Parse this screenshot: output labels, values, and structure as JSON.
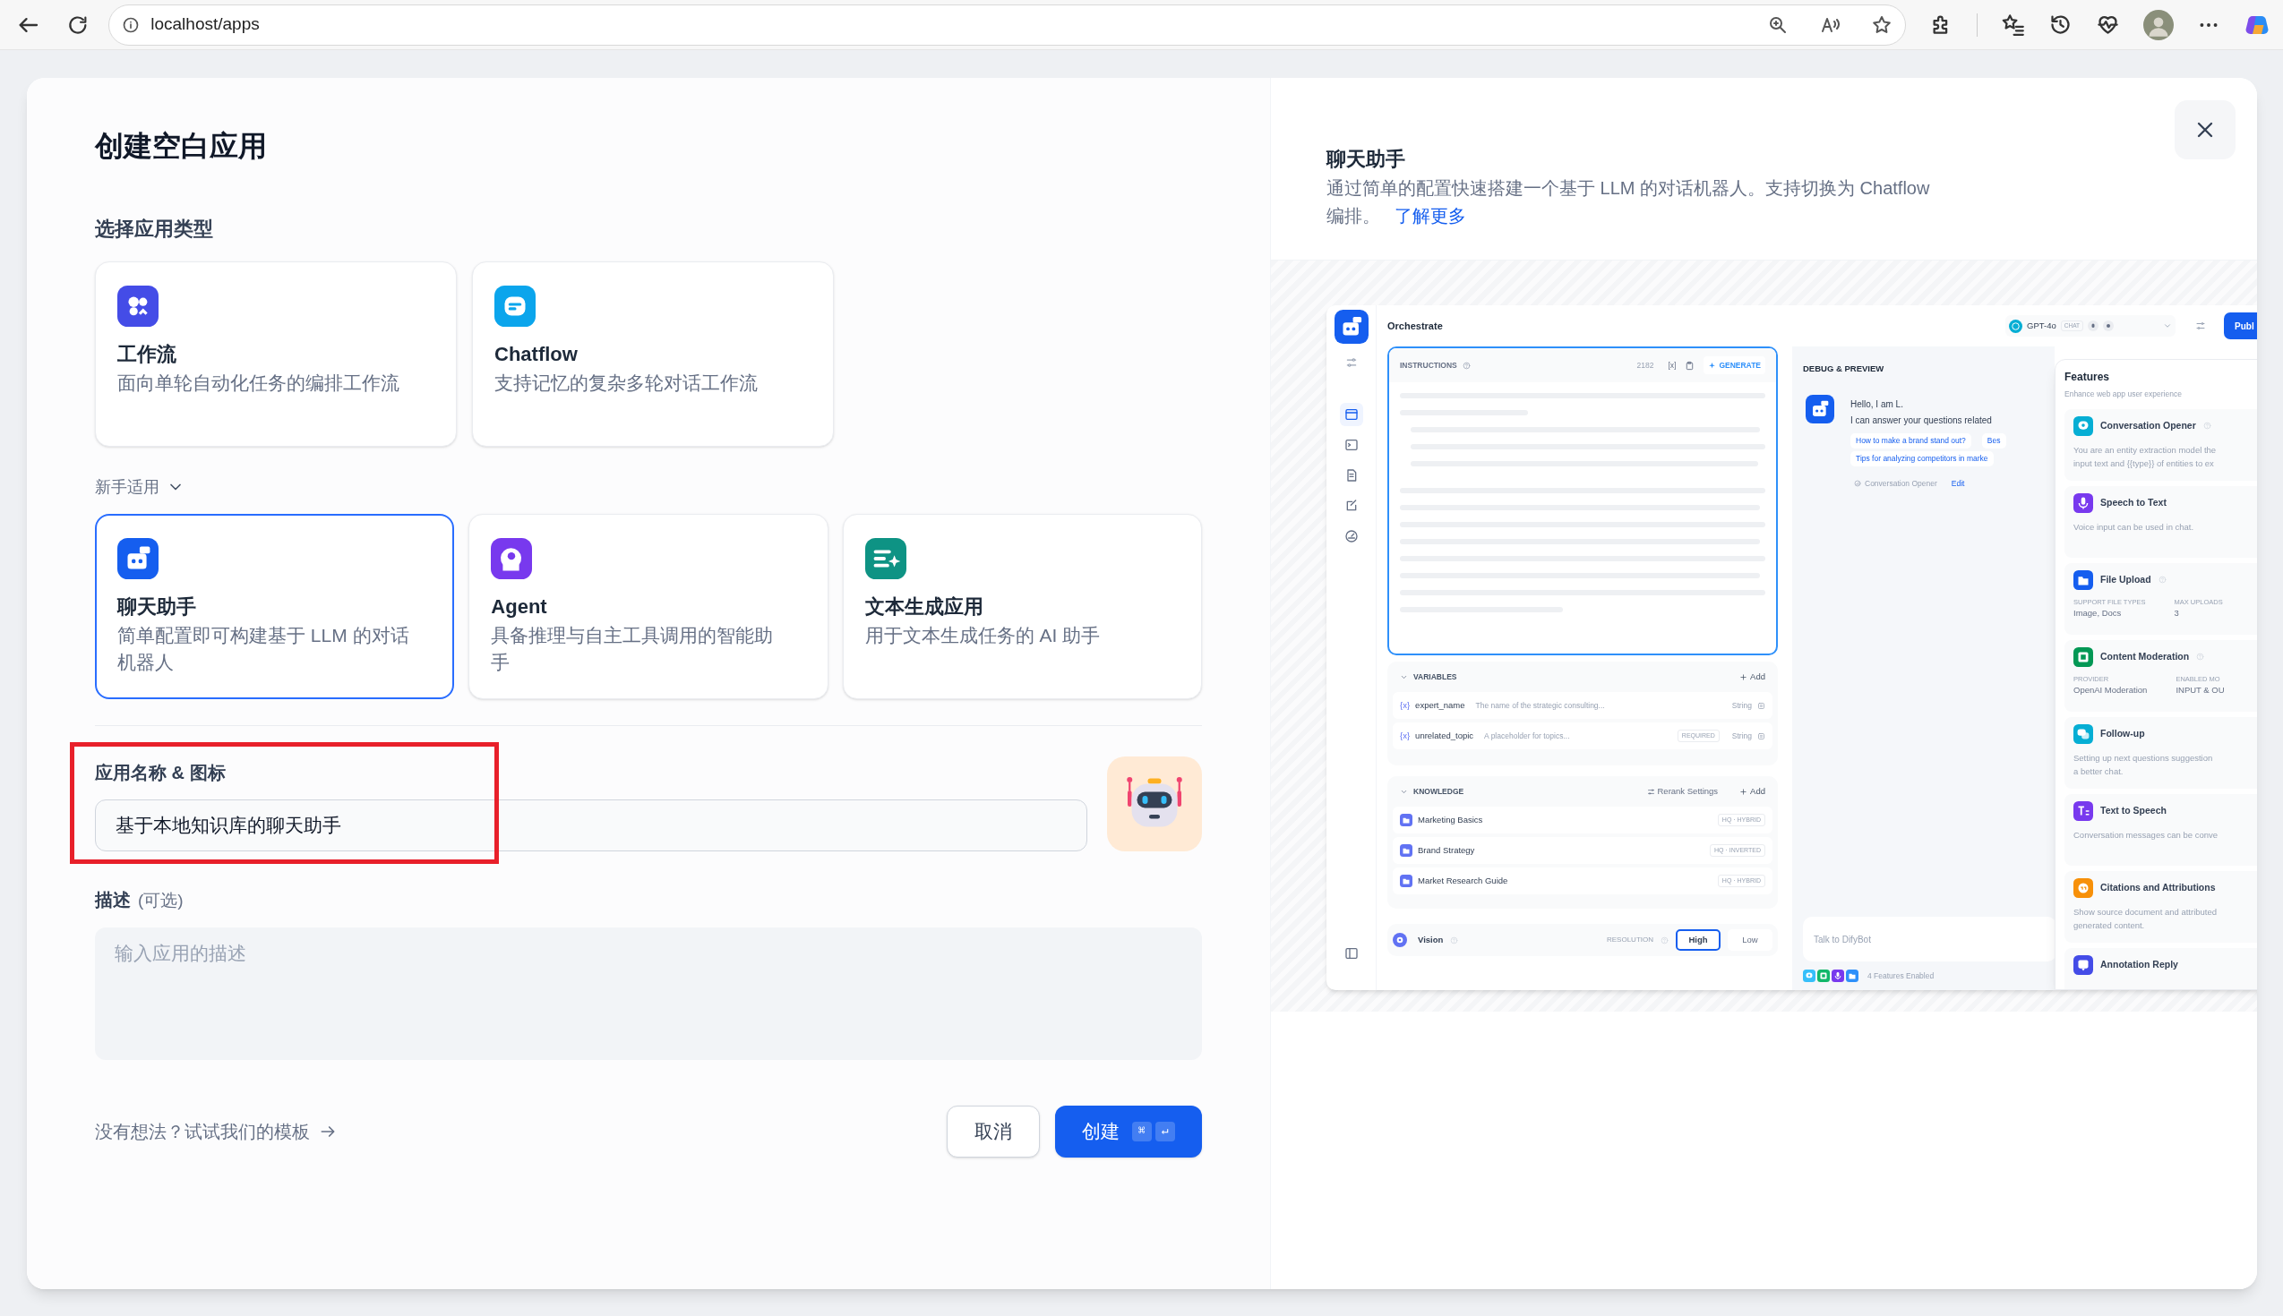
{
  "browser": {
    "url": "localhost/apps"
  },
  "title": "创建空白应用",
  "section_label": "选择应用类型",
  "app_types": [
    {
      "name": "工作流",
      "description": "面向单轮自动化任务的编排工作流",
      "color": "#444ce7",
      "selected": false
    },
    {
      "name": "Chatflow",
      "description": "支持记忆的复杂多轮对话工作流",
      "color": "#0ba5ec",
      "selected": false
    }
  ],
  "beginner_toggle": {
    "label": "新手适用",
    "expanded": true
  },
  "beginner_types": [
    {
      "name": "聊天助手",
      "description": "简单配置即可构建基于 LLM 的对话机器人",
      "color": "#155eef",
      "selected": true
    },
    {
      "name": "Agent",
      "description": "具备推理与自主工具调用的智能助手",
      "color": "#7839ee",
      "selected": false
    },
    {
      "name": "文本生成应用",
      "description": "用于文本生成任务的 AI 助手",
      "color": "#0e9384",
      "selected": false
    }
  ],
  "name_field": {
    "label": "应用名称 & 图标",
    "value": "基于本地知识库的聊天助手",
    "highlighted": true
  },
  "description_field": {
    "label": "描述",
    "note": "(可选)",
    "placeholder": "输入应用的描述"
  },
  "template_link": "没有想法？试试我们的模板",
  "buttons": {
    "cancel": "取消",
    "create": "创建",
    "shortcut": [
      "⌘",
      "↵"
    ]
  },
  "preview": {
    "title": "聊天助手",
    "description": "通过简单的配置快速搭建一个基于 LLM 的对话机器人。支持切换为 Chatflow 编排。",
    "link": "了解更多",
    "mock": {
      "heading": "Orchestrate",
      "model": "GPT-4o",
      "model_tag": "CHAT",
      "publish": "Publ",
      "instructions": {
        "label": "INSTRUCTIONS",
        "count": "2182",
        "var_token": "[x]",
        "generate": "GENERATE"
      },
      "variables": {
        "label": "VARIABLES",
        "add": "Add",
        "items": [
          {
            "token": "{x}",
            "name": "expert_name",
            "description": "The name of the strategic consulting...",
            "type": "String"
          },
          {
            "token": "{x}",
            "name": "unrelated_topic",
            "description": "A placeholder for topics...",
            "badge": "REQUIRED",
            "type": "String"
          }
        ]
      },
      "knowledge": {
        "label": "KNOWLEDGE",
        "rerank": "Rerank Settings",
        "add": "Add",
        "items": [
          {
            "name": "Marketing Basics",
            "mode": "HQ · HYBRID"
          },
          {
            "name": "Brand Strategy",
            "mode": "HQ · INVERTED"
          },
          {
            "name": "Market Research Guide",
            "mode": "HQ · HYBRID"
          }
        ]
      },
      "vision": {
        "label": "Vision",
        "resolution_label": "RESOLUTION",
        "options": [
          {
            "label": "High",
            "selected": true
          },
          {
            "label": "Low",
            "selected": false
          }
        ]
      },
      "debug": {
        "label": "DEBUG & PREVIEW",
        "greeting": "Hello, I am L.",
        "message": "I can answer your questions related",
        "suggestions": [
          "How to make a brand stand out?",
          "Bes",
          "Tips for analyzing competitors in marke"
        ],
        "opener_note": "Conversation Opener",
        "edit": "Edit",
        "input_placeholder": "Talk to DifyBot",
        "features_enabled": "4 Features Enabled"
      },
      "features": {
        "title": "Features",
        "subtitle": "Enhance web app user experience",
        "items": [
          {
            "name": "Conversation Opener",
            "color": "#06aed4",
            "help": true,
            "lines": [
              "You are an entity extraction model the",
              "input text and {{type}} of entities to ex"
            ]
          },
          {
            "name": "Speech to Text",
            "color": "#7839ee",
            "help": false,
            "lines": [
              "Voice input can be used in chat."
            ]
          },
          {
            "name": "File Upload",
            "color": "#155eef",
            "help": true,
            "fields": [
              {
                "label": "SUPPORT FILE TYPES",
                "value": "Image, Docs"
              },
              {
                "label": "MAX UPLOADS",
                "value": "3"
              }
            ]
          },
          {
            "name": "Content Moderation",
            "color": "#039855",
            "help": true,
            "fields": [
              {
                "label": "PROVIDER",
                "value": "OpenAI Moderation"
              },
              {
                "label": "ENABLED MO",
                "value": "INPUT & OU"
              }
            ]
          },
          {
            "name": "Follow-up",
            "color": "#06aed4",
            "help": false,
            "lines": [
              "Setting up next questions suggestion",
              "a better chat."
            ]
          },
          {
            "name": "Text to Speech",
            "color": "#7839ee",
            "help": false,
            "lines": [
              "Conversation messages can be conve"
            ]
          },
          {
            "name": "Citations and Attributions",
            "color": "#f79009",
            "help": false,
            "lines": [
              "Show source document and attributed",
              "generated content."
            ]
          },
          {
            "name": "Annotation Reply",
            "color": "#444ce7",
            "help": false
          }
        ]
      }
    }
  }
}
